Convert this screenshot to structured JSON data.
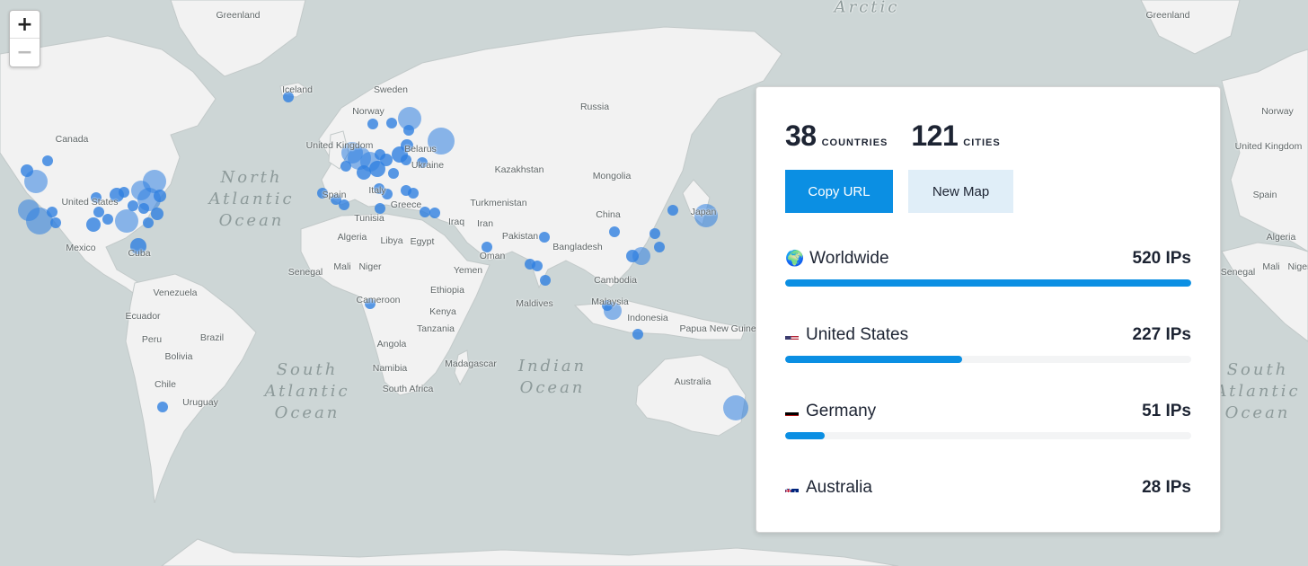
{
  "map": {
    "zoom_in_label": "+",
    "zoom_out_label": "−",
    "labels": [
      "Greenland",
      "Arctic",
      "Greenland",
      "Iceland",
      "Sweden",
      "Norway",
      "Canada",
      "Russia",
      "United Kingdom",
      "Belarus",
      "Ukraine",
      "Kazakhstan",
      "Mongolia",
      "United States",
      "Spain",
      "Italy",
      "Turkmenistan",
      "China",
      "Japan",
      "Tunisia",
      "Greece",
      "Iraq",
      "Iran",
      "Algeria",
      "Libya",
      "Egypt",
      "Mexico",
      "Cuba",
      "Pakistan",
      "Bangladesh",
      "Oman",
      "Senegal",
      "Mali",
      "Niger",
      "Yemen",
      "Ethiopia",
      "Venezuela",
      "Cambodia",
      "Cameroon",
      "Malaysia",
      "Maldives",
      "Ecuador",
      "Kenya",
      "Indonesia",
      "Papua New Guinea",
      "Peru",
      "Brazil",
      "Tanzania",
      "Angola",
      "Bolivia",
      "Madagascar",
      "Namibia",
      "Chile",
      "South Africa",
      "Australia",
      "Uruguay",
      "Norway",
      "United Kingdom",
      "Spain",
      "Algeria",
      "Senegal",
      "Mali",
      "Niger"
    ],
    "oceans": [
      "North Atlantic Ocean",
      "South Atlantic Ocean",
      "Indian Ocean",
      "South Atlantic Ocean"
    ]
  },
  "stats": {
    "countries_count": "38",
    "countries_label": "COUNTRIES",
    "cities_count": "121",
    "cities_label": "CITIES"
  },
  "buttons": {
    "copy_url": "Copy URL",
    "new_map": "New Map"
  },
  "accent_color": "#0b8fe3",
  "rows": [
    {
      "name": "Worldwide",
      "value": "520 IPs",
      "count": 520,
      "icon": "globe-icon"
    },
    {
      "name": "United States",
      "value": "227 IPs",
      "count": 227,
      "icon": "us-flag-icon"
    },
    {
      "name": "Germany",
      "value": "51 IPs",
      "count": 51,
      "icon": "germany-flag-icon"
    },
    {
      "name": "Australia",
      "value": "28 IPs",
      "count": 28,
      "icon": "australia-flag-icon"
    }
  ]
}
